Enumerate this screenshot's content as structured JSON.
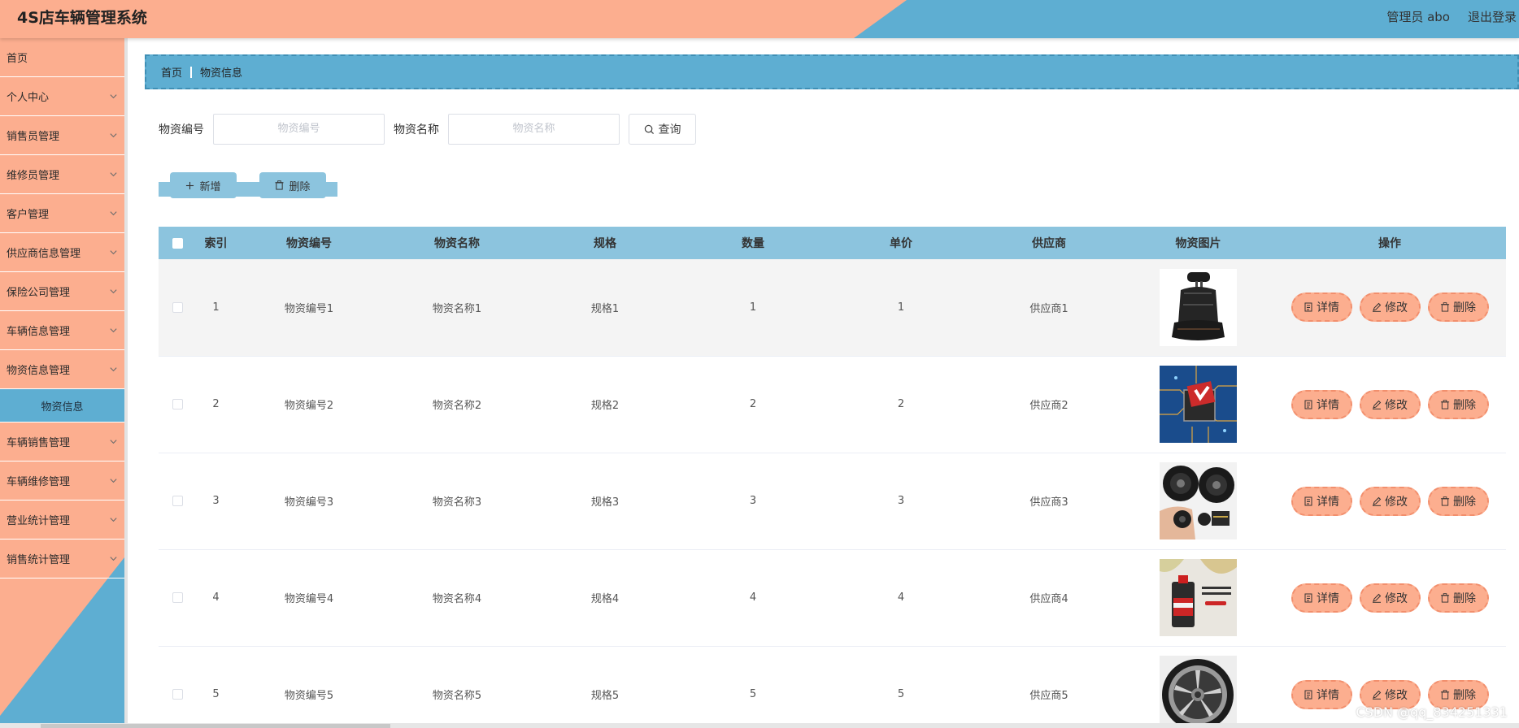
{
  "header": {
    "title": "4S店车辆管理系统",
    "user_label": "管理员 abo",
    "logout_label": "退出登录",
    "colors": {
      "salmon": "#fcae8f",
      "blue": "#5eaed2"
    }
  },
  "sidebar": {
    "items": [
      {
        "label": "首页",
        "has_arrow": false
      },
      {
        "label": "个人中心",
        "has_arrow": true
      },
      {
        "label": "销售员管理",
        "has_arrow": true
      },
      {
        "label": "维修员管理",
        "has_arrow": true
      },
      {
        "label": "客户管理",
        "has_arrow": true
      },
      {
        "label": "供应商信息管理",
        "has_arrow": true
      },
      {
        "label": "保险公司管理",
        "has_arrow": true
      },
      {
        "label": "车辆信息管理",
        "has_arrow": true
      },
      {
        "label": "物资信息管理",
        "has_arrow": true
      }
    ],
    "active_sub": "物资信息",
    "items_after": [
      {
        "label": "车辆销售管理",
        "has_arrow": true
      },
      {
        "label": "车辆维修管理",
        "has_arrow": true
      },
      {
        "label": "营业统计管理",
        "has_arrow": true
      },
      {
        "label": "销售统计管理",
        "has_arrow": true
      }
    ]
  },
  "breadcrumb": {
    "home": "首页",
    "current": "物资信息"
  },
  "search": {
    "code_label": "物资编号",
    "code_placeholder": "物资编号",
    "name_label": "物资名称",
    "name_placeholder": "物资名称",
    "query_label": "查询"
  },
  "actions": {
    "add_label": "新增",
    "delete_label": "删除"
  },
  "table": {
    "headers": [
      "索引",
      "物资编号",
      "物资名称",
      "规格",
      "数量",
      "单价",
      "供应商",
      "物资图片",
      "操作"
    ],
    "rows": [
      {
        "index": "1",
        "code": "物资编号1",
        "name": "物资名称1",
        "spec": "规格1",
        "qty": "1",
        "price": "1",
        "supplier": "供应商1",
        "image": "car-seat"
      },
      {
        "index": "2",
        "code": "物资编号2",
        "name": "物资名称2",
        "spec": "规格2",
        "qty": "2",
        "price": "2",
        "supplier": "供应商2",
        "image": "chip"
      },
      {
        "index": "3",
        "code": "物资编号3",
        "name": "物资名称3",
        "spec": "规格3",
        "qty": "3",
        "price": "3",
        "supplier": "供应商3",
        "image": "speakers"
      },
      {
        "index": "4",
        "code": "物资编号4",
        "name": "物资名称4",
        "spec": "规格4",
        "qty": "4",
        "price": "4",
        "supplier": "供应商4",
        "image": "engine-oil"
      },
      {
        "index": "5",
        "code": "物资编号5",
        "name": "物资名称5",
        "spec": "规格5",
        "qty": "5",
        "price": "5",
        "supplier": "供应商5",
        "image": "wheel-rim"
      }
    ],
    "row_actions": {
      "detail": "详情",
      "edit": "修改",
      "delete": "删除"
    }
  },
  "watermark": "CSDN @qq_834251331"
}
